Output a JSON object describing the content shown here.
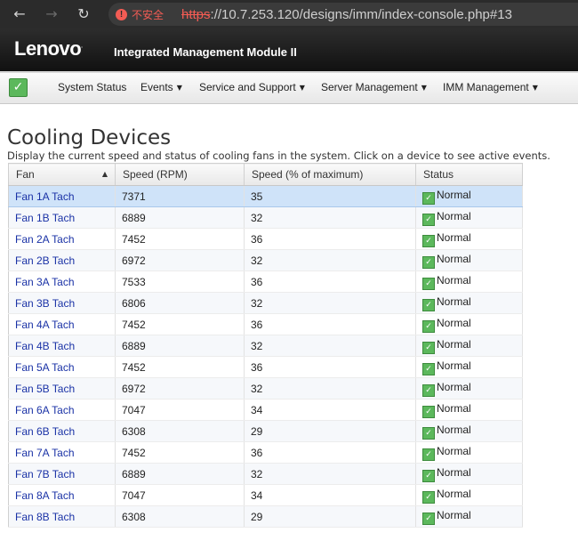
{
  "browser": {
    "security_label": "不安全",
    "url_scheme": "https",
    "url_rest": "://10.7.253.120/designs/imm/index-console.php#13"
  },
  "header": {
    "logo": "Lenovo",
    "title": "Integrated Management Module II"
  },
  "menu": {
    "items": [
      {
        "label": "System Status",
        "dropdown": false
      },
      {
        "label": "Events",
        "dropdown": true
      },
      {
        "label": "Service and Support",
        "dropdown": true
      },
      {
        "label": "Server Management",
        "dropdown": true
      },
      {
        "label": "IMM Management",
        "dropdown": true
      }
    ]
  },
  "page": {
    "title": "Cooling Devices",
    "description": "Display the current speed and status of cooling fans in the system. Click on a device to see active events."
  },
  "table": {
    "columns": [
      "Fan",
      "Speed (RPM)",
      "Speed (% of maximum)",
      "Status"
    ],
    "sorted_column": "Fan",
    "sort_direction": "ascending",
    "selected_row": "Fan 1A Tach",
    "rows": [
      {
        "fan": "Fan 1A Tach",
        "rpm": "7371",
        "percent": "35",
        "status": "Normal"
      },
      {
        "fan": "Fan 1B Tach",
        "rpm": "6889",
        "percent": "32",
        "status": "Normal"
      },
      {
        "fan": "Fan 2A Tach",
        "rpm": "7452",
        "percent": "36",
        "status": "Normal"
      },
      {
        "fan": "Fan 2B Tach",
        "rpm": "6972",
        "percent": "32",
        "status": "Normal"
      },
      {
        "fan": "Fan 3A Tach",
        "rpm": "7533",
        "percent": "36",
        "status": "Normal"
      },
      {
        "fan": "Fan 3B Tach",
        "rpm": "6806",
        "percent": "32",
        "status": "Normal"
      },
      {
        "fan": "Fan 4A Tach",
        "rpm": "7452",
        "percent": "36",
        "status": "Normal"
      },
      {
        "fan": "Fan 4B Tach",
        "rpm": "6889",
        "percent": "32",
        "status": "Normal"
      },
      {
        "fan": "Fan 5A Tach",
        "rpm": "7452",
        "percent": "36",
        "status": "Normal"
      },
      {
        "fan": "Fan 5B Tach",
        "rpm": "6972",
        "percent": "32",
        "status": "Normal"
      },
      {
        "fan": "Fan 6A Tach",
        "rpm": "7047",
        "percent": "34",
        "status": "Normal"
      },
      {
        "fan": "Fan 6B Tach",
        "rpm": "6308",
        "percent": "29",
        "status": "Normal"
      },
      {
        "fan": "Fan 7A Tach",
        "rpm": "7452",
        "percent": "36",
        "status": "Normal"
      },
      {
        "fan": "Fan 7B Tach",
        "rpm": "6889",
        "percent": "32",
        "status": "Normal"
      },
      {
        "fan": "Fan 8A Tach",
        "rpm": "7047",
        "percent": "34",
        "status": "Normal"
      },
      {
        "fan": "Fan 8B Tach",
        "rpm": "6308",
        "percent": "29",
        "status": "Normal"
      }
    ]
  },
  "icons": {
    "back": "back-arrow-icon",
    "forward": "forward-arrow-icon",
    "reload": "reload-icon",
    "security_warning": "warning-icon",
    "system_status": "green-check-icon",
    "status_normal": "green-check-icon",
    "sort": "sort-up-icon"
  },
  "colors": {
    "link": "#1a32a6",
    "status_ok": "#5cb85c",
    "selected_row": "#cfe3f9",
    "insecure_warning": "#f25c54"
  }
}
